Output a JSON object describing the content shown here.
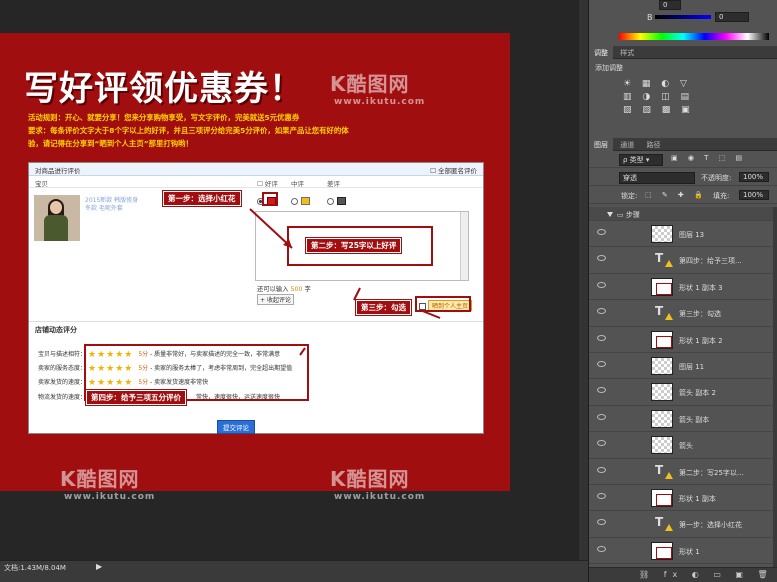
{
  "document": {
    "title": "写好评领优惠券！",
    "rules_line1": "活动规则：开心、就要分享！您来分享购物享受，写文字评价，完美就送5元优惠券",
    "rules_line2": "要求：每条评价文字大于8个字以上的好评，并且三项评分给完美5分评价，如果产品让您有好的体",
    "rules_line3": "验，请记得在分享到“晒到个人主页”那里打钩哟！"
  },
  "watermark": {
    "logo": "K酷图网",
    "url": "www.ikutu.com"
  },
  "form": {
    "header": "对商品进行评价",
    "anonymous": "全部匿名评价",
    "col_product": "宝贝",
    "col_good": "好评",
    "col_mid": "中评",
    "col_bad": "差评",
    "product_link": "2015新款 韩版修身 冬款 毛呢外套",
    "remain_prefix": "还可以输入",
    "remain_count": "500",
    "remain_suffix": "字",
    "collapse": "收起评论",
    "share_label": "晒到个人主页",
    "store_title": "店铺动态评分",
    "ratings": [
      {
        "label": "宝贝与描述相符：",
        "score": "5分",
        "desc": "- 质量非常好，与卖家描述的完全一致，非常满意"
      },
      {
        "label": "卖家的服务态度：",
        "score": "5分",
        "desc": "- 卖家的服务太棒了，考虑非常周到，完全超出期望值"
      },
      {
        "label": "卖家发货的速度：",
        "score": "5分",
        "desc": "- 卖家发货速度非常快"
      },
      {
        "label": "物流发货的速度：",
        "score": "",
        "desc": "常快，速度很快，运送速度很快"
      }
    ],
    "submit": "提交评论"
  },
  "callouts": {
    "step1": "第一步：选择小红花",
    "step2": "第二步：写25字以上好评",
    "step3": "第三步：勾选",
    "step4": "第四步：给予三项五分评价"
  },
  "status": {
    "doc_size": "文档:1.43M/8.04M"
  },
  "right_panel": {
    "adjust_tabs": [
      "调整",
      "样式"
    ],
    "adjust_title": "添加调整",
    "layer_tabs": [
      "图层",
      "通道",
      "路径"
    ],
    "kind_label": "类型",
    "blend_mode": "穿透",
    "opacity_label": "不透明度:",
    "opacity_value": "100%",
    "lock_label": "锁定:",
    "fill_label": "填充:",
    "fill_value": "100%",
    "value_b": "0",
    "value_top": "0",
    "group_name": "步骤",
    "layers": [
      {
        "name": "图层 13",
        "type": "image"
      },
      {
        "name": "第四步：给予三项...",
        "type": "text"
      },
      {
        "name": "形状 1 副本 3",
        "type": "shape"
      },
      {
        "name": "第三步：勾选",
        "type": "text"
      },
      {
        "name": "形状 1 副本 2",
        "type": "shape"
      },
      {
        "name": "图层 11",
        "type": "image"
      },
      {
        "name": "箭头 副本 2",
        "type": "image"
      },
      {
        "name": "箭头 副本",
        "type": "image"
      },
      {
        "name": "箭头",
        "type": "image"
      },
      {
        "name": "第二步：写25字以...",
        "type": "text"
      },
      {
        "name": "形状 1 副本",
        "type": "shape"
      },
      {
        "name": "第一步：选择小红花",
        "type": "text"
      },
      {
        "name": "形状 1",
        "type": "shape"
      }
    ]
  }
}
